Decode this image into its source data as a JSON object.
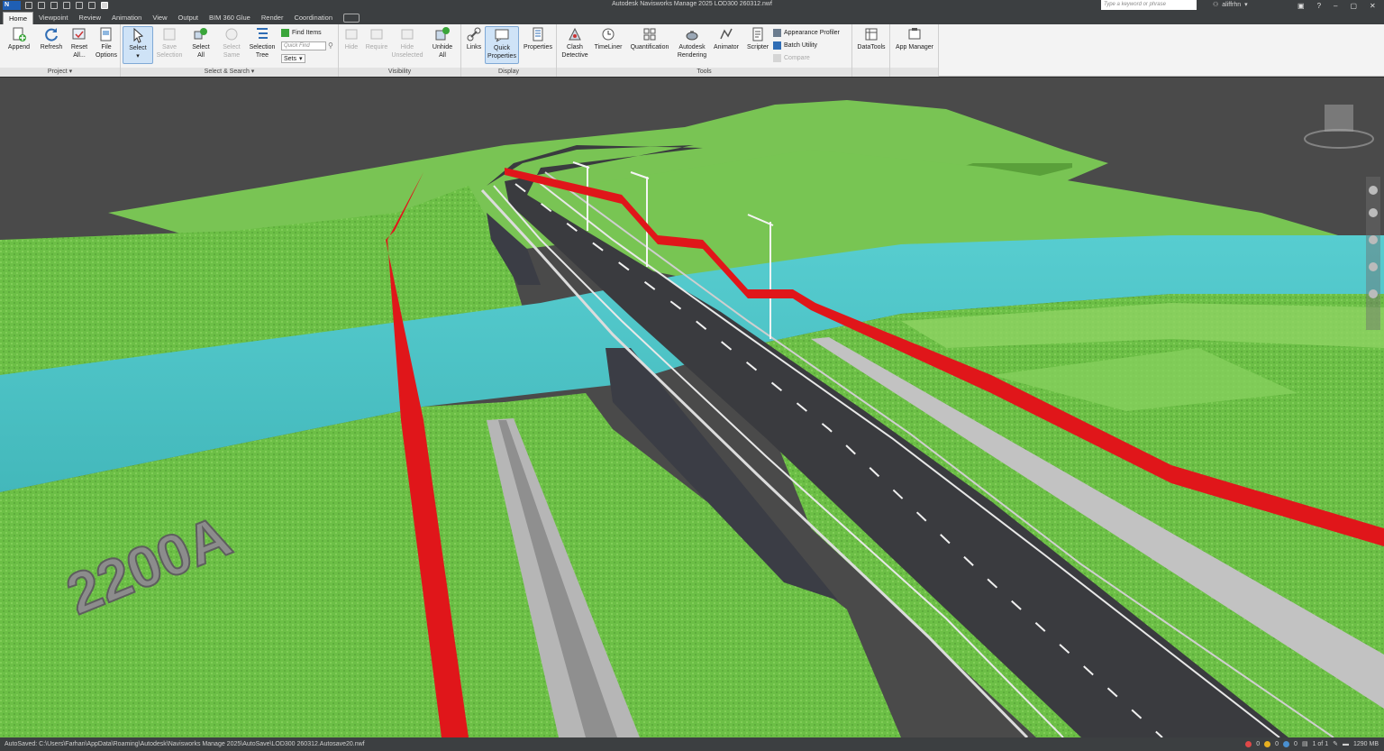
{
  "titlebar": {
    "logo": "N",
    "title": "Autodesk Navisworks Manage 2025   LOD300 260312.nwf",
    "search_placeholder": "Type a keyword or phrase",
    "user": "aliffrhn",
    "help": "?"
  },
  "tabs": [
    {
      "label": "Home",
      "active": true
    },
    {
      "label": "Viewpoint"
    },
    {
      "label": "Review"
    },
    {
      "label": "Animation"
    },
    {
      "label": "View"
    },
    {
      "label": "Output"
    },
    {
      "label": "BIM 360 Glue"
    },
    {
      "label": "Render"
    },
    {
      "label": "Coordination"
    }
  ],
  "ribbon": {
    "project": {
      "title": "Project ▾",
      "append": "Append",
      "refresh": "Refresh",
      "reset_all_1": "Reset",
      "reset_all_2": "All...",
      "file_options_1": "File",
      "file_options_2": "Options"
    },
    "select_search": {
      "title": "Select & Search ▾",
      "select": "Select",
      "save_selection_1": "Save",
      "save_selection_2": "Selection",
      "select_all_1": "Select",
      "select_all_2": "All",
      "select_same_1": "Select",
      "select_same_2": "Same",
      "selection_tree_1": "Selection",
      "selection_tree_2": "Tree",
      "find_items": "Find Items",
      "quick_find_placeholder": "Quick Find",
      "sets": "Sets"
    },
    "visibility": {
      "title": "Visibility",
      "hide": "Hide",
      "require": "Require",
      "hide_unselected_1": "Hide",
      "hide_unselected_2": "Unselected",
      "unhide_all_1": "Unhide",
      "unhide_all_2": "All"
    },
    "display": {
      "title": "Display",
      "links": "Links",
      "quick_properties_1": "Quick",
      "quick_properties_2": "Properties",
      "properties": "Properties"
    },
    "tools": {
      "title": "Tools",
      "clash_detective_1": "Clash",
      "clash_detective_2": "Detective",
      "timeliner": "TimeLiner",
      "quantification": "Quantification",
      "autodesk_rendering_1": "Autodesk",
      "autodesk_rendering_2": "Rendering",
      "animator": "Animator",
      "scripter": "Scripter",
      "appearance_profiler": "Appearance Profiler",
      "batch_utility": "Batch Utility",
      "compare": "Compare"
    },
    "datatools": "DataTools",
    "app_manager": "App Manager"
  },
  "scene": {
    "label_3d": "2200A",
    "colors": {
      "sky": "#4a4a4a",
      "grass": "#6fc04a",
      "water": "#4fc3c6",
      "road": "#3a3b3f",
      "alignment": "#e0161a"
    }
  },
  "statusbar": {
    "path": "AutoSaved: C:\\Users\\Farhan\\AppData\\Roaming\\Autodesk\\Navisworks Manage 2025\\AutoSave\\LOD300 260312.Autosave20.nwf",
    "count_1": "0",
    "count_2": "0",
    "count_3": "0",
    "page": "1 of 1",
    "memory": "1290 MB"
  }
}
